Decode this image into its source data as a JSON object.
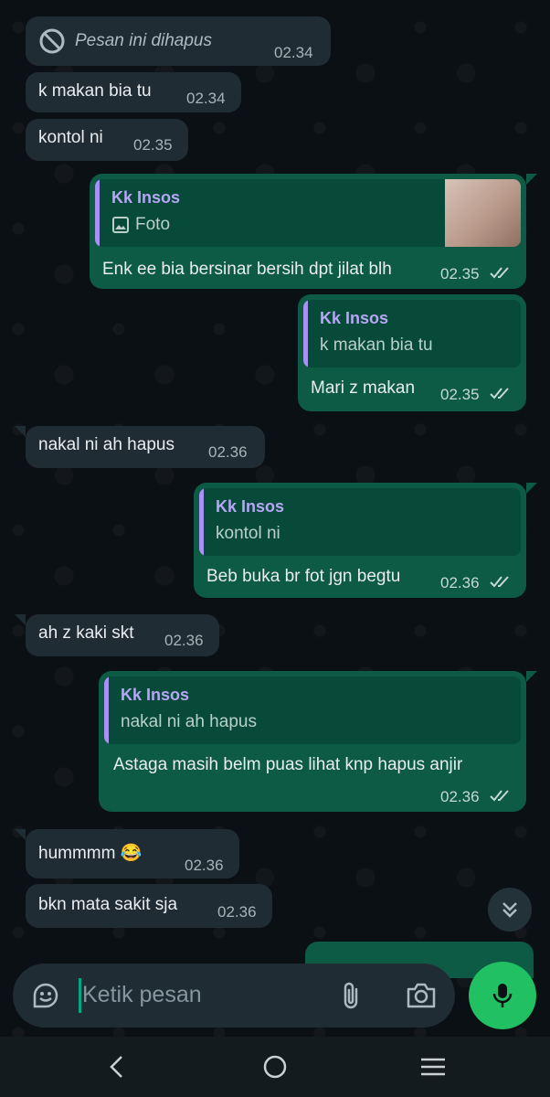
{
  "contact_name": "Kk Insos",
  "messages": [
    {
      "type": "in",
      "deleted": true,
      "text": "Pesan ini dihapus",
      "time": "02.34"
    },
    {
      "type": "in",
      "text": "k makan bia tu",
      "time": "02.34"
    },
    {
      "type": "in",
      "text": "kontol ni",
      "time": "02.35"
    },
    {
      "type": "out",
      "quote_author": "Kk Insos",
      "quote_text": "Foto",
      "text": "Enk ee bia bersinar bersih dpt jilat blh",
      "time": "02.35"
    },
    {
      "type": "out",
      "quote_author": "Kk Insos",
      "quote_text": "k makan bia tu",
      "text": "Mari z makan",
      "time": "02.35"
    },
    {
      "type": "in",
      "text": "nakal ni ah hapus",
      "time": "02.36"
    },
    {
      "type": "out",
      "quote_author": "Kk Insos",
      "quote_text": "kontol ni",
      "text": "Beb buka br fot jgn begtu",
      "time": "02.36"
    },
    {
      "type": "in",
      "text": "ah z kaki skt",
      "time": "02.36"
    },
    {
      "type": "out",
      "quote_author": "Kk Insos",
      "quote_text": "nakal ni ah hapus",
      "text": "Astaga masih belm puas lihat knp hapus anjir",
      "time": "02.36"
    },
    {
      "type": "in",
      "text": "hummmm 😂",
      "time": "02.36"
    },
    {
      "type": "in",
      "text": "bkn mata sakit sja",
      "time": "02.36"
    }
  ],
  "input": {
    "placeholder": "Ketik pesan"
  },
  "icons": {
    "sticker": "sticker-icon",
    "attach": "paperclip-icon",
    "camera": "camera-icon",
    "mic": "microphone-icon",
    "scroll": "double-chevron-down-icon",
    "back": "back-icon",
    "home": "home-icon",
    "recents": "recents-icon"
  },
  "colors": {
    "accent": "#21c063",
    "outgoing": "#0d5a45",
    "incoming": "#202c33",
    "quote_bar": "#a791f2"
  }
}
